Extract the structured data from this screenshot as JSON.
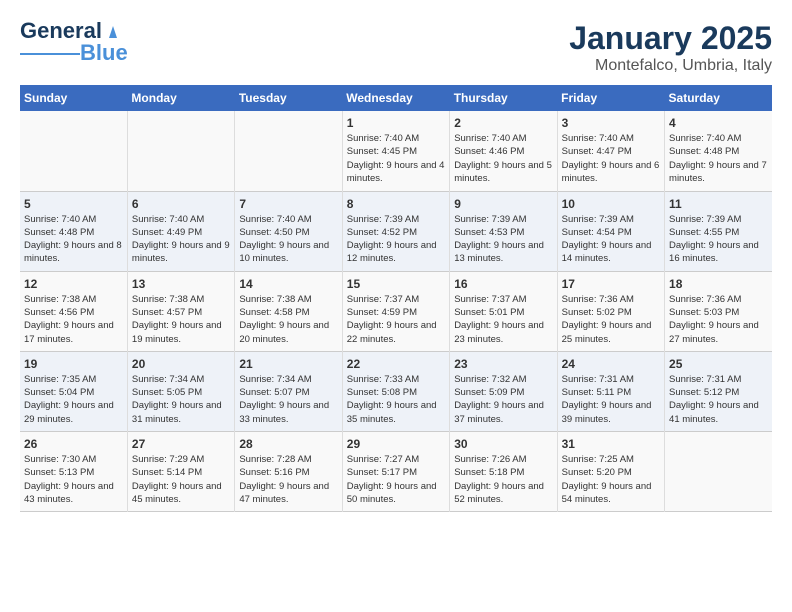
{
  "logo": {
    "line1": "General",
    "line2": "Blue"
  },
  "title": "January 2025",
  "subtitle": "Montefalco, Umbria, Italy",
  "days_of_week": [
    "Sunday",
    "Monday",
    "Tuesday",
    "Wednesday",
    "Thursday",
    "Friday",
    "Saturday"
  ],
  "weeks": [
    [
      {
        "day": "",
        "info": ""
      },
      {
        "day": "",
        "info": ""
      },
      {
        "day": "",
        "info": ""
      },
      {
        "day": "1",
        "info": "Sunrise: 7:40 AM\nSunset: 4:45 PM\nDaylight: 9 hours and 4 minutes."
      },
      {
        "day": "2",
        "info": "Sunrise: 7:40 AM\nSunset: 4:46 PM\nDaylight: 9 hours and 5 minutes."
      },
      {
        "day": "3",
        "info": "Sunrise: 7:40 AM\nSunset: 4:47 PM\nDaylight: 9 hours and 6 minutes."
      },
      {
        "day": "4",
        "info": "Sunrise: 7:40 AM\nSunset: 4:48 PM\nDaylight: 9 hours and 7 minutes."
      }
    ],
    [
      {
        "day": "5",
        "info": "Sunrise: 7:40 AM\nSunset: 4:48 PM\nDaylight: 9 hours and 8 minutes."
      },
      {
        "day": "6",
        "info": "Sunrise: 7:40 AM\nSunset: 4:49 PM\nDaylight: 9 hours and 9 minutes."
      },
      {
        "day": "7",
        "info": "Sunrise: 7:40 AM\nSunset: 4:50 PM\nDaylight: 9 hours and 10 minutes."
      },
      {
        "day": "8",
        "info": "Sunrise: 7:39 AM\nSunset: 4:52 PM\nDaylight: 9 hours and 12 minutes."
      },
      {
        "day": "9",
        "info": "Sunrise: 7:39 AM\nSunset: 4:53 PM\nDaylight: 9 hours and 13 minutes."
      },
      {
        "day": "10",
        "info": "Sunrise: 7:39 AM\nSunset: 4:54 PM\nDaylight: 9 hours and 14 minutes."
      },
      {
        "day": "11",
        "info": "Sunrise: 7:39 AM\nSunset: 4:55 PM\nDaylight: 9 hours and 16 minutes."
      }
    ],
    [
      {
        "day": "12",
        "info": "Sunrise: 7:38 AM\nSunset: 4:56 PM\nDaylight: 9 hours and 17 minutes."
      },
      {
        "day": "13",
        "info": "Sunrise: 7:38 AM\nSunset: 4:57 PM\nDaylight: 9 hours and 19 minutes."
      },
      {
        "day": "14",
        "info": "Sunrise: 7:38 AM\nSunset: 4:58 PM\nDaylight: 9 hours and 20 minutes."
      },
      {
        "day": "15",
        "info": "Sunrise: 7:37 AM\nSunset: 4:59 PM\nDaylight: 9 hours and 22 minutes."
      },
      {
        "day": "16",
        "info": "Sunrise: 7:37 AM\nSunset: 5:01 PM\nDaylight: 9 hours and 23 minutes."
      },
      {
        "day": "17",
        "info": "Sunrise: 7:36 AM\nSunset: 5:02 PM\nDaylight: 9 hours and 25 minutes."
      },
      {
        "day": "18",
        "info": "Sunrise: 7:36 AM\nSunset: 5:03 PM\nDaylight: 9 hours and 27 minutes."
      }
    ],
    [
      {
        "day": "19",
        "info": "Sunrise: 7:35 AM\nSunset: 5:04 PM\nDaylight: 9 hours and 29 minutes."
      },
      {
        "day": "20",
        "info": "Sunrise: 7:34 AM\nSunset: 5:05 PM\nDaylight: 9 hours and 31 minutes."
      },
      {
        "day": "21",
        "info": "Sunrise: 7:34 AM\nSunset: 5:07 PM\nDaylight: 9 hours and 33 minutes."
      },
      {
        "day": "22",
        "info": "Sunrise: 7:33 AM\nSunset: 5:08 PM\nDaylight: 9 hours and 35 minutes."
      },
      {
        "day": "23",
        "info": "Sunrise: 7:32 AM\nSunset: 5:09 PM\nDaylight: 9 hours and 37 minutes."
      },
      {
        "day": "24",
        "info": "Sunrise: 7:31 AM\nSunset: 5:11 PM\nDaylight: 9 hours and 39 minutes."
      },
      {
        "day": "25",
        "info": "Sunrise: 7:31 AM\nSunset: 5:12 PM\nDaylight: 9 hours and 41 minutes."
      }
    ],
    [
      {
        "day": "26",
        "info": "Sunrise: 7:30 AM\nSunset: 5:13 PM\nDaylight: 9 hours and 43 minutes."
      },
      {
        "day": "27",
        "info": "Sunrise: 7:29 AM\nSunset: 5:14 PM\nDaylight: 9 hours and 45 minutes."
      },
      {
        "day": "28",
        "info": "Sunrise: 7:28 AM\nSunset: 5:16 PM\nDaylight: 9 hours and 47 minutes."
      },
      {
        "day": "29",
        "info": "Sunrise: 7:27 AM\nSunset: 5:17 PM\nDaylight: 9 hours and 50 minutes."
      },
      {
        "day": "30",
        "info": "Sunrise: 7:26 AM\nSunset: 5:18 PM\nDaylight: 9 hours and 52 minutes."
      },
      {
        "day": "31",
        "info": "Sunrise: 7:25 AM\nSunset: 5:20 PM\nDaylight: 9 hours and 54 minutes."
      },
      {
        "day": "",
        "info": ""
      }
    ]
  ]
}
